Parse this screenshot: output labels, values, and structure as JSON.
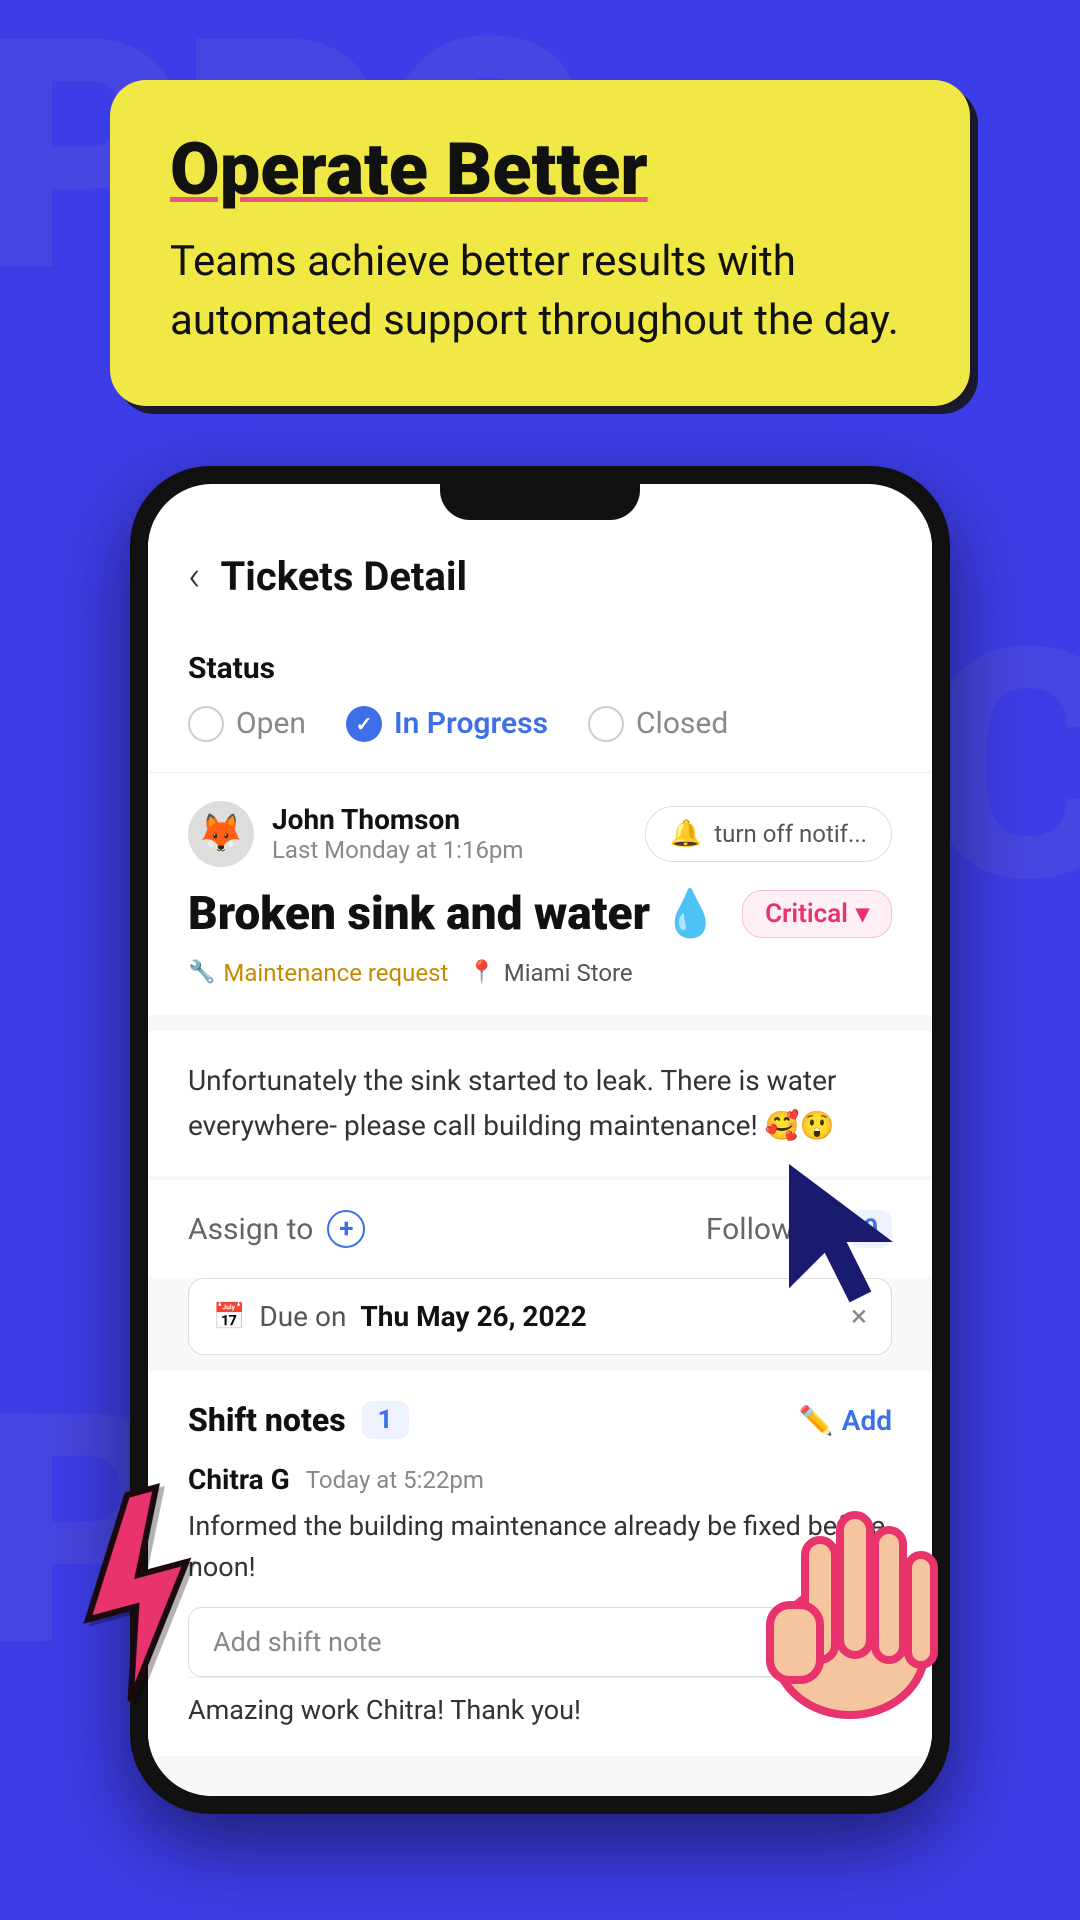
{
  "hero": {
    "title": "Operate Better",
    "subtitle": "Teams achieve better results with automated support throughout the day."
  },
  "app": {
    "header": {
      "back_label": "‹",
      "title": "Tickets Detail"
    },
    "status": {
      "label": "Status",
      "options": [
        {
          "id": "open",
          "label": "Open",
          "active": false
        },
        {
          "id": "in_progress",
          "label": "In Progress",
          "active": true
        },
        {
          "id": "closed",
          "label": "Closed",
          "active": false
        }
      ]
    },
    "ticket": {
      "author": "John Thomson",
      "time": "Last Monday at 1:16pm",
      "notif_btn": "turn off notif...",
      "title": "Broken sink and water 💧",
      "priority": "Critical",
      "priority_arrow": "▾",
      "tags": [
        {
          "icon": "🔧",
          "label": "Maintenance request",
          "type": "maintenance"
        },
        {
          "icon": "📍",
          "label": "Miami Store",
          "type": "location"
        }
      ],
      "description": "Unfortunately the sink started to leak. There is water everywhere- please call building maintenance! 🥰😲"
    },
    "assign": {
      "label": "Assign to",
      "plus_icon": "+"
    },
    "followers": {
      "label": "Followers",
      "count": "0"
    },
    "due_date": {
      "label": "Due on",
      "date": "Thu May 26, 2022",
      "close_icon": "×"
    },
    "shift_notes": {
      "title": "Shift notes",
      "count": "1",
      "add_btn": "Add",
      "note": {
        "author": "Chitra G",
        "time": "Today at 5:22pm",
        "text": "Informed the building maintenance already be fixed before noon!"
      },
      "add_placeholder": "Add shift note",
      "comment": "Amazing work Chitra! Thank you!"
    }
  },
  "colors": {
    "primary": "#3d3de8",
    "accent_blue": "#3d6fe8",
    "accent_red": "#e8336c",
    "accent_yellow": "#f0e844",
    "critical_text": "#e8336c",
    "maintenance_color": "#c68a00"
  }
}
